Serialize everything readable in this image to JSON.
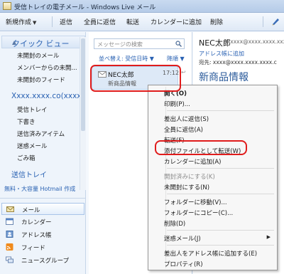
{
  "window": {
    "title": "受信トレイの電子メール - Windows Live メール"
  },
  "toolbar": {
    "new_label": "新規作成",
    "reply_label": "返信",
    "reply_all_label": "全員に返信",
    "forward_label": "転送",
    "add_calendar_label": "カレンダーに追加",
    "delete_label": "削除"
  },
  "sidebar": {
    "quick_views_header": "クイック ビュー",
    "quick_items": [
      "未開封のメール",
      "メンバーからの未開...",
      "未開封のフィード"
    ],
    "account_name": "Xxxx.xxxx.co(xxxx",
    "folders": [
      "受信トレイ",
      "下書き",
      "送信済みアイテム",
      "迷惑メール",
      "ごみ箱"
    ],
    "outbox_label": "送信トレイ",
    "promo_link": "無料・大容量 Hotmail 作成",
    "nav": [
      "メール",
      "カレンダー",
      "アドレス帳",
      "フィード",
      "ニュースグループ"
    ]
  },
  "message_list": {
    "search_placeholder": "メッセージの検索",
    "sort_label": "並べ替え: 受信日時",
    "sort_direction": "降順",
    "message": {
      "from": "NEC太郎",
      "subject": "新商品情報",
      "time": "17:12"
    }
  },
  "reading_pane": {
    "from": "NEC太郎",
    "from_address": "[ xxxx@xxxx.xxxx.xxxx.c",
    "add_contact": "アドレス帳に追加",
    "to": "宛先: xxxx@xxxx.xxxx.xxxx.c",
    "subject": "新商品情報"
  },
  "context_menu": {
    "items": [
      "開く(O)",
      "印刷(P)...",
      "差出人に返信(S)",
      "全員に返信(A)",
      "転送(F)",
      "添付ファイルとして転送(W)",
      "カレンダーに追加(A)",
      "開封済みにする(K)",
      "未開封にする(N)",
      "フォルダーに移動(V)...",
      "フォルダーにコピー(C)...",
      "削除(D)",
      "迷惑メール(J)",
      "差出人をアドレス帳に追加する(E)",
      "プロパティ(R)"
    ]
  },
  "colors": {
    "accent_blue": "#2a62b3",
    "highlight_red": "#e01c1c"
  }
}
